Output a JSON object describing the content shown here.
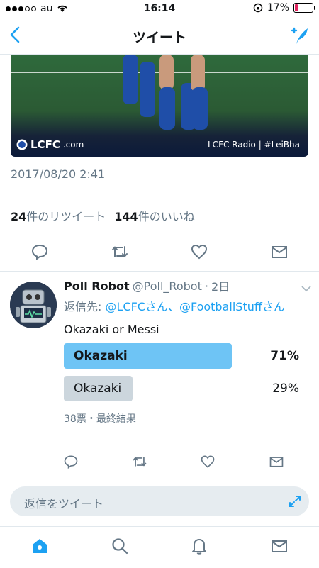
{
  "status": {
    "carrier": "au",
    "time": "16:14",
    "battery": "17%",
    "battery_level": 0.17
  },
  "nav": {
    "title": "ツイート"
  },
  "media": {
    "brand": "LCFC",
    "brand_suffix": ".com",
    "caption": "LCFC Radio | #LeiBha"
  },
  "tweet": {
    "timestamp": "2017/08/20 2:41",
    "retweets_count": "24",
    "retweets_label": "件のリツイート",
    "likes_count": "144",
    "likes_label": "件のいいね"
  },
  "reply": {
    "name": "Poll Robot",
    "handle": "@Poll_Robot",
    "time": "2日",
    "reply_prefix": "返信先: ",
    "reply_targets": "@LCFCさん、@FootballStuffさん",
    "text": "Okazaki or Messi",
    "poll": [
      {
        "label": "Okazaki",
        "percent_text": "71%",
        "fraction": 0.71,
        "winner": true
      },
      {
        "label": "Okazaki",
        "percent_text": "29%",
        "fraction": 0.29,
        "winner": false
      }
    ],
    "poll_meta": "38票・最終結果"
  },
  "compose": {
    "placeholder": "返信をツイート"
  },
  "colors": {
    "accent": "#1da1f2",
    "poll_winner": "#6ec4f5",
    "poll_loser": "#ccd6dd"
  }
}
